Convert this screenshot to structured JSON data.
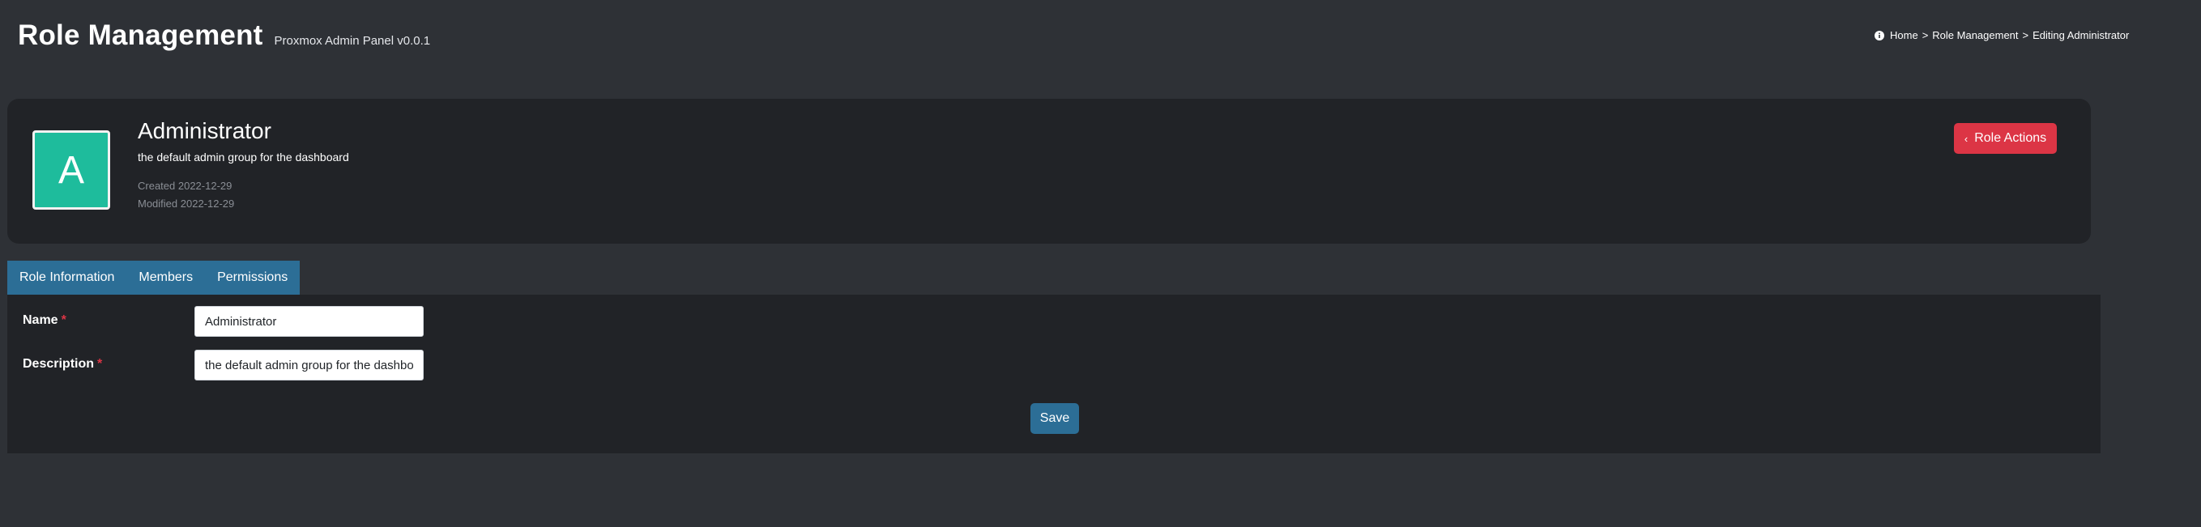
{
  "header": {
    "title": "Role Management",
    "subtitle": "Proxmox Admin Panel v0.0.1"
  },
  "breadcrumb": {
    "icon": "info-icon",
    "items": [
      "Home",
      "Role Management",
      "Editing Administrator"
    ],
    "separator": ">"
  },
  "role": {
    "avatar_letter": "A",
    "name": "Administrator",
    "description": "the default admin group for the dashboard",
    "created": "Created 2022-12-29",
    "modified": "Modified 2022-12-29",
    "actions_label": "Role Actions",
    "actions_icon": "chevron-left-icon"
  },
  "tabs": [
    {
      "label": "Role Information"
    },
    {
      "label": "Members"
    },
    {
      "label": "Permissions"
    }
  ],
  "form": {
    "name_label": "Name",
    "description_label": "Description",
    "required_marker": "*",
    "name_value": "Administrator",
    "description_value": "the default admin group for the dashboard",
    "save_label": "Save"
  },
  "colors": {
    "background": "#2e3136",
    "card": "#212327",
    "accent": "#2c6e96",
    "danger": "#dc3545",
    "avatar": "#1ebc9c"
  }
}
